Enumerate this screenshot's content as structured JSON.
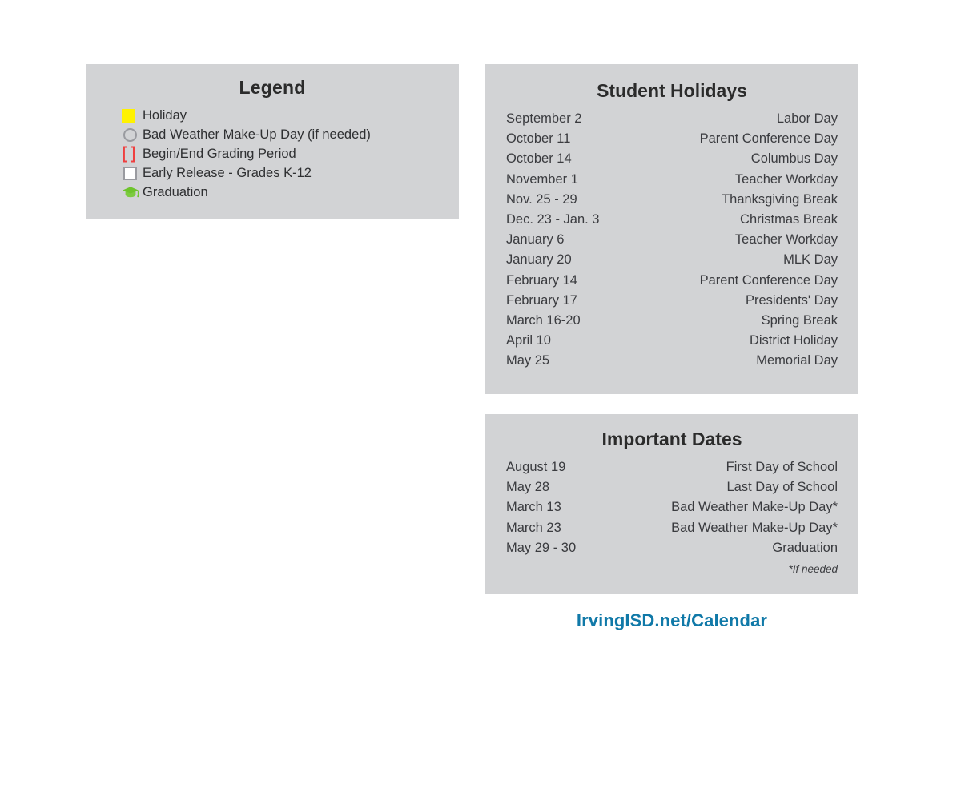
{
  "legend": {
    "title": "Legend",
    "items": [
      {
        "icon": "yellow-square-icon",
        "label": "Holiday"
      },
      {
        "icon": "gray-circle-icon",
        "label": "Bad Weather Make-Up Day (if needed)"
      },
      {
        "icon": "red-brackets-icon",
        "label": "Begin/End Grading Period",
        "glyph": "[ ]"
      },
      {
        "icon": "gray-square-icon",
        "label": "Early Release - Grades K-12"
      },
      {
        "icon": "graduation-cap-icon",
        "label": "Graduation"
      }
    ],
    "colors": {
      "holiday": "#fff200",
      "bad_weather": "#9a9ba0",
      "grading_period": "#ef3f3f",
      "early_release": "#9a9ba0",
      "graduation": "#6ec42c"
    }
  },
  "student_holidays": {
    "title": "Student Holidays",
    "rows": [
      {
        "date": "September 2",
        "desc": "Labor Day"
      },
      {
        "date": "October 11",
        "desc": "Parent Conference Day"
      },
      {
        "date": "October 14",
        "desc": "Columbus Day"
      },
      {
        "date": "November 1",
        "desc": "Teacher Workday"
      },
      {
        "date": "Nov. 25 - 29",
        "desc": "Thanksgiving Break"
      },
      {
        "date": "Dec. 23 - Jan. 3",
        "desc": "Christmas Break"
      },
      {
        "date": "January 6",
        "desc": "Teacher Workday"
      },
      {
        "date": "January 20",
        "desc": "MLK Day"
      },
      {
        "date": "February 14",
        "desc": "Parent Conference Day"
      },
      {
        "date": "February 17",
        "desc": "Presidents' Day"
      },
      {
        "date": "March 16-20",
        "desc": "Spring Break"
      },
      {
        "date": "April 10",
        "desc": "District Holiday"
      },
      {
        "date": "May 25",
        "desc": "Memorial Day"
      }
    ]
  },
  "important_dates": {
    "title": "Important Dates",
    "rows": [
      {
        "date": "August 19",
        "desc": "First Day of School"
      },
      {
        "date": "May 28",
        "desc": "Last Day of School"
      },
      {
        "date": "March 13",
        "desc": "Bad Weather Make-Up Day*"
      },
      {
        "date": "March 23",
        "desc": "Bad Weather Make-Up Day*"
      },
      {
        "date": "May 29 - 30",
        "desc": "Graduation"
      }
    ],
    "footnote": "*If needed"
  },
  "url": {
    "label": "IrvingISD.net/Calendar",
    "color": "#1079a8"
  },
  "panel_background": "#d2d3d5"
}
